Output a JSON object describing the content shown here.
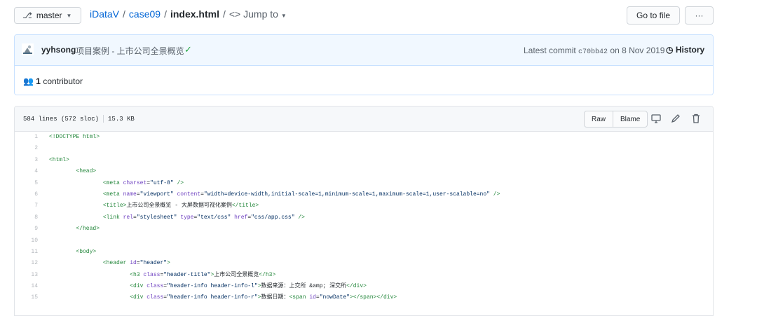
{
  "branch": {
    "icon": "git-branch-icon",
    "label": "master"
  },
  "breadcrumb": {
    "repo": "iDataV",
    "folder": "case09",
    "file": "index.html",
    "separator": "/",
    "jump": "Jump to"
  },
  "goto_file_label": "Go to file",
  "more_label": "···",
  "commit": {
    "author": "yyhsong",
    "message": "项目案例 - 上市公司全景概览",
    "latest_label": "Latest commit",
    "sha": "c70bb42",
    "date_text": "on 8 Nov 2019",
    "history_label": "History"
  },
  "contributors": {
    "count": "1",
    "label": "contributor"
  },
  "file": {
    "lines_info": "584 lines (572 sloc)",
    "size": "15.3 KB",
    "raw_label": "Raw",
    "blame_label": "Blame"
  },
  "code_lines": [
    {
      "n": "1",
      "tokens": [
        [
          "t",
          "<!DOCTYPE html>"
        ]
      ]
    },
    {
      "n": "2",
      "tokens": []
    },
    {
      "n": "3",
      "tokens": [
        [
          "t",
          "<html>"
        ]
      ]
    },
    {
      "n": "4",
      "tokens": [
        [
          "p",
          "        "
        ],
        [
          "t",
          "<head>"
        ]
      ]
    },
    {
      "n": "5",
      "tokens": [
        [
          "p",
          "                "
        ],
        [
          "t",
          "<meta "
        ],
        [
          "a",
          "charset"
        ],
        [
          "p",
          "="
        ],
        [
          "s",
          "\"utf-8\""
        ],
        [
          "t",
          " />"
        ]
      ]
    },
    {
      "n": "6",
      "tokens": [
        [
          "p",
          "                "
        ],
        [
          "t",
          "<meta "
        ],
        [
          "a",
          "name"
        ],
        [
          "p",
          "="
        ],
        [
          "s",
          "\"viewport\""
        ],
        [
          "p",
          " "
        ],
        [
          "a",
          "content"
        ],
        [
          "p",
          "="
        ],
        [
          "s",
          "\"width=device-width,initial-scale=1,minimum-scale=1,maximum-scale=1,user-scalable=no\""
        ],
        [
          "t",
          " />"
        ]
      ]
    },
    {
      "n": "7",
      "tokens": [
        [
          "p",
          "                "
        ],
        [
          "t",
          "<title>"
        ],
        [
          "p",
          "上市公司全景概览 - 大屏数据可视化案例"
        ],
        [
          "t",
          "</title>"
        ]
      ]
    },
    {
      "n": "8",
      "tokens": [
        [
          "p",
          "                "
        ],
        [
          "t",
          "<link "
        ],
        [
          "a",
          "rel"
        ],
        [
          "p",
          "="
        ],
        [
          "s",
          "\"stylesheet\""
        ],
        [
          "p",
          " "
        ],
        [
          "a",
          "type"
        ],
        [
          "p",
          "="
        ],
        [
          "s",
          "\"text/css\""
        ],
        [
          "p",
          " "
        ],
        [
          "a",
          "href"
        ],
        [
          "p",
          "="
        ],
        [
          "s",
          "\"css/app.css\""
        ],
        [
          "t",
          " />"
        ]
      ]
    },
    {
      "n": "9",
      "tokens": [
        [
          "p",
          "        "
        ],
        [
          "t",
          "</head>"
        ]
      ]
    },
    {
      "n": "10",
      "tokens": []
    },
    {
      "n": "11",
      "tokens": [
        [
          "p",
          "        "
        ],
        [
          "t",
          "<body>"
        ]
      ]
    },
    {
      "n": "12",
      "tokens": [
        [
          "p",
          "                "
        ],
        [
          "t",
          "<header "
        ],
        [
          "a",
          "id"
        ],
        [
          "p",
          "="
        ],
        [
          "s",
          "\"header\""
        ],
        [
          "t",
          ">"
        ]
      ]
    },
    {
      "n": "13",
      "tokens": [
        [
          "p",
          "                        "
        ],
        [
          "t",
          "<h3 "
        ],
        [
          "a",
          "class"
        ],
        [
          "p",
          "="
        ],
        [
          "s",
          "\"header-title\""
        ],
        [
          "t",
          ">"
        ],
        [
          "p",
          "上市公司全景概览"
        ],
        [
          "t",
          "</h3>"
        ]
      ]
    },
    {
      "n": "14",
      "tokens": [
        [
          "p",
          "                        "
        ],
        [
          "t",
          "<div "
        ],
        [
          "a",
          "class"
        ],
        [
          "p",
          "="
        ],
        [
          "s",
          "\"header-info header-info-l\""
        ],
        [
          "t",
          ">"
        ],
        [
          "p",
          "数据来源：上交所 &amp; 深交所"
        ],
        [
          "t",
          "</div>"
        ]
      ]
    },
    {
      "n": "15",
      "tokens": [
        [
          "p",
          "                        "
        ],
        [
          "t",
          "<div "
        ],
        [
          "a",
          "class"
        ],
        [
          "p",
          "="
        ],
        [
          "s",
          "\"header-info header-info-r\""
        ],
        [
          "t",
          ">"
        ],
        [
          "p",
          "数据日期："
        ],
        [
          "t",
          "<span "
        ],
        [
          "a",
          "id"
        ],
        [
          "p",
          "="
        ],
        [
          "s",
          "\"nowDate\""
        ],
        [
          "t",
          "></span></div>"
        ]
      ]
    }
  ]
}
